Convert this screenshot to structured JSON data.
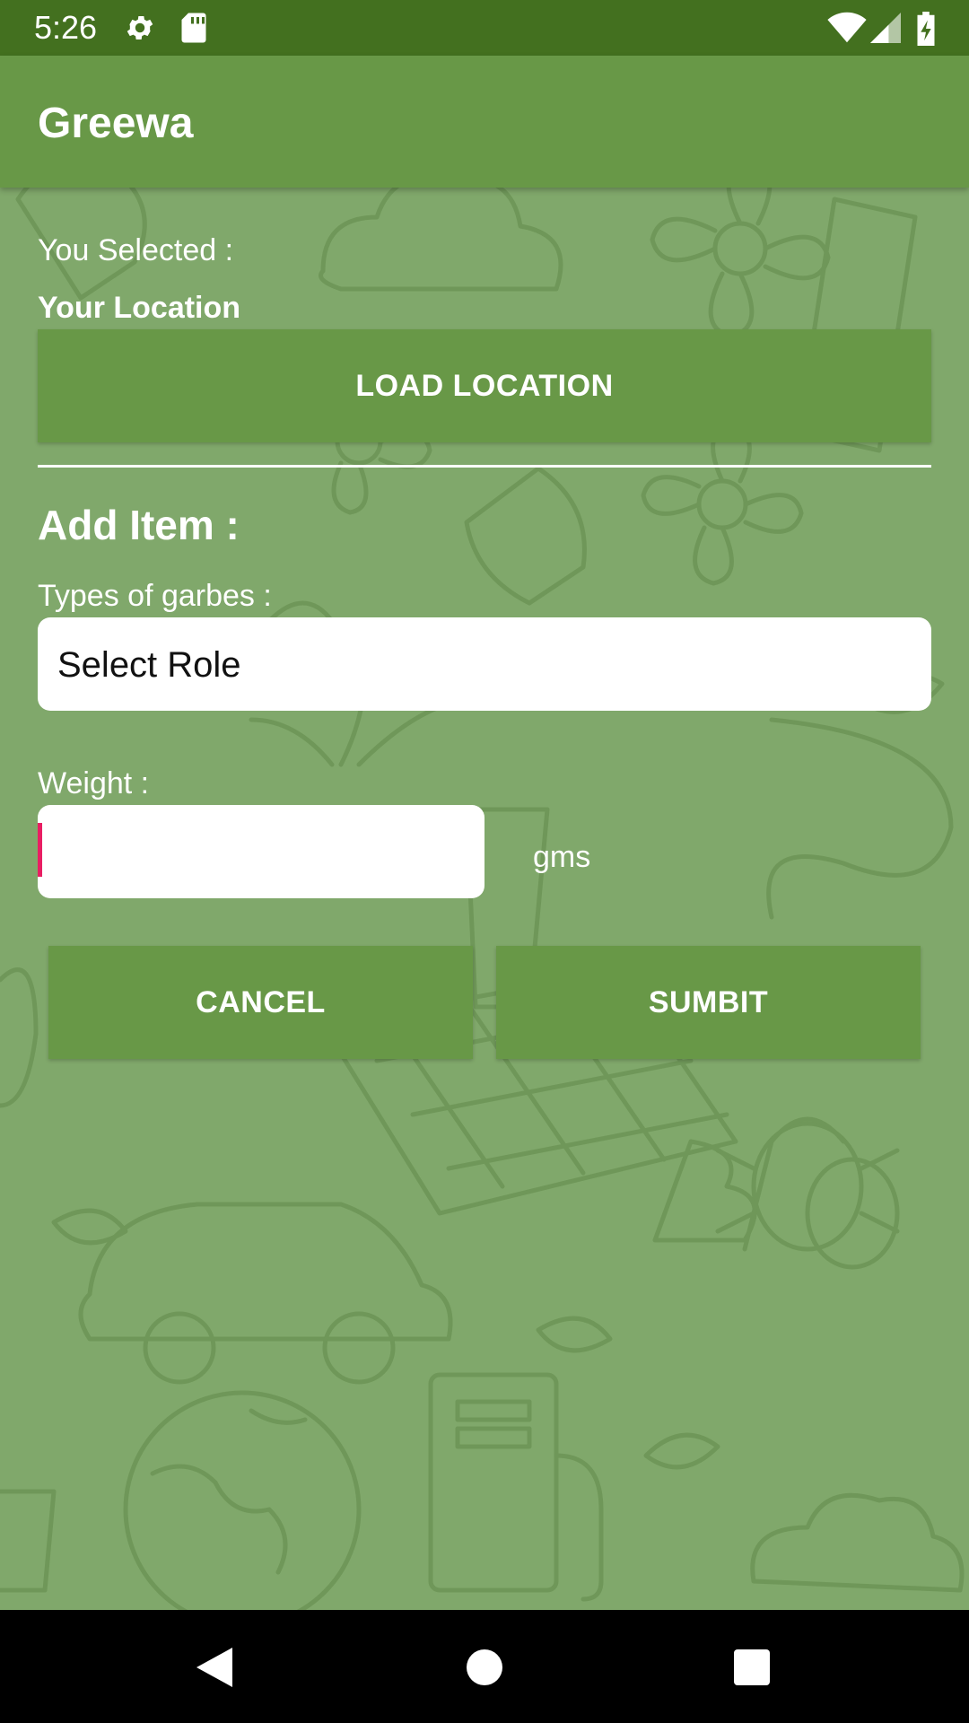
{
  "status_bar": {
    "time": "5:26",
    "icons": [
      "gear-icon",
      "sd-card-icon",
      "wifi-icon",
      "signal-icon",
      "battery-charging-icon"
    ]
  },
  "app_bar": {
    "title": "Greewa"
  },
  "location": {
    "selected_label": "You Selected :",
    "selected_value": "Your Location",
    "load_button": "LOAD LOCATION"
  },
  "add_item": {
    "heading": "Add Item :",
    "garbage_label": "Types of garbes :",
    "garbage_select_value": "Select Role",
    "weight_label": "Weight :",
    "weight_value": "",
    "weight_unit": "gms"
  },
  "actions": {
    "cancel": "CANCEL",
    "submit": "SUMBIT"
  },
  "nav_bar": {
    "icons": [
      "back-icon",
      "home-icon",
      "recents-icon"
    ]
  },
  "colors": {
    "status_bar": "#43701f",
    "app_bar": "#689847",
    "background": "#80a86b",
    "button": "#689847",
    "caret": "#e91e63"
  }
}
